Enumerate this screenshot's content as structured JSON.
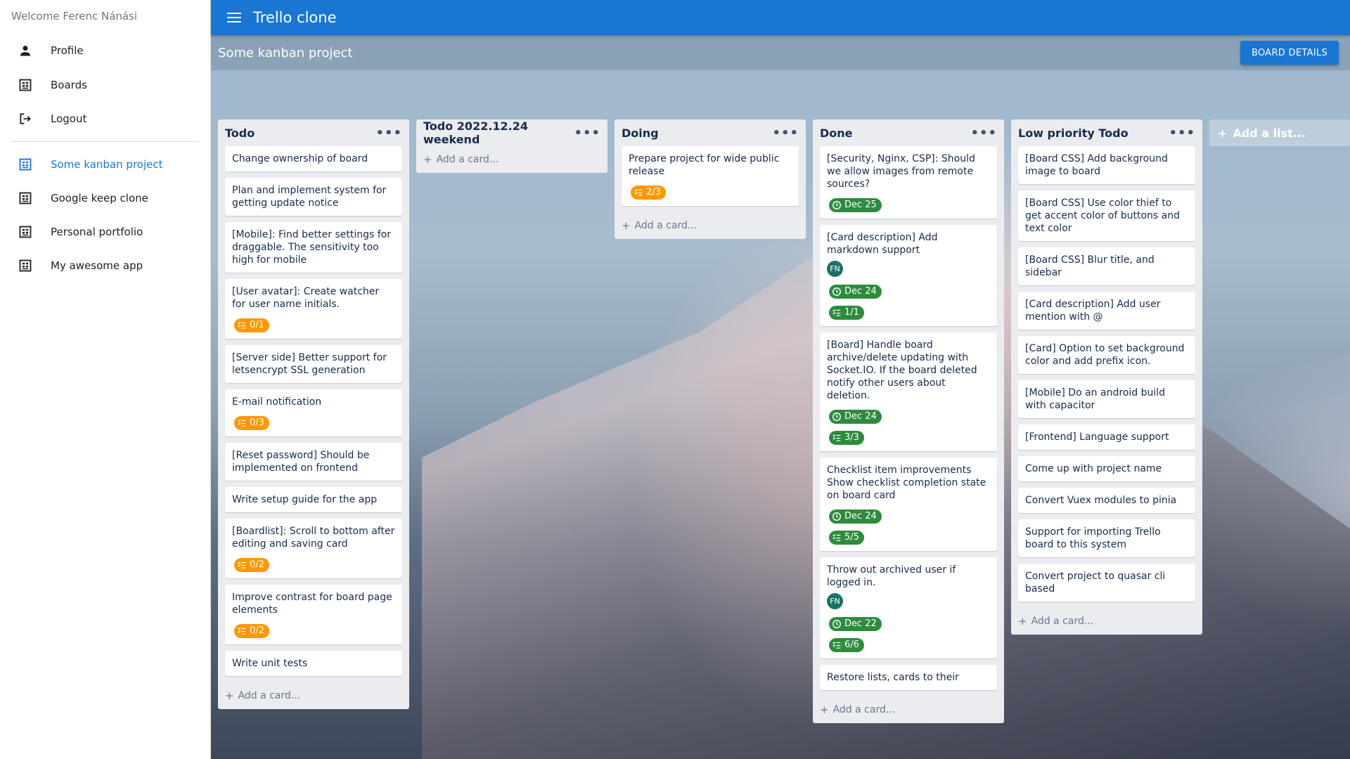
{
  "app": {
    "title": "Trello clone"
  },
  "sidebar": {
    "welcome": "Welcome Ferenc Nánási",
    "items": [
      {
        "label": "Profile",
        "icon": "person-icon"
      },
      {
        "label": "Boards",
        "icon": "board-icon"
      },
      {
        "label": "Logout",
        "icon": "logout-icon"
      }
    ],
    "boards": [
      {
        "label": "Some kanban project",
        "active": true
      },
      {
        "label": "Google keep clone"
      },
      {
        "label": "Personal portfolio"
      },
      {
        "label": "My awesome app"
      }
    ]
  },
  "board": {
    "name": "Some kanban project",
    "details_label": "BOARD DETAILS",
    "add_list_label": "Add a list...",
    "add_card_label": "Add a card..."
  },
  "colors": {
    "primary": "#1976d2",
    "checklist_badge": "#ff9800",
    "due_badge": "#2e8b3e",
    "avatar": "#1b7267"
  },
  "lists": [
    {
      "title": "Todo",
      "cards": [
        {
          "text": "Change ownership of board"
        },
        {
          "text": "Plan and implement system for getting update notice"
        },
        {
          "text": "[Mobile]: Find better settings for draggable. The sensitivity too high for mobile"
        },
        {
          "text": "[User avatar]: Create watcher for user name initials.",
          "checklist": "0/1"
        },
        {
          "text": "[Server side] Better support for letsencrypt SSL generation"
        },
        {
          "text": "E-mail notification",
          "checklist": "0/3"
        },
        {
          "text": "[Reset password] Should be implemented on frontend"
        },
        {
          "text": "Write setup guide for the app"
        },
        {
          "text": "[Boardlist]: Scroll to bottom after editing and saving card",
          "checklist": "0/2"
        },
        {
          "text": "Improve contrast for board page elements",
          "checklist": "0/2"
        },
        {
          "text": "Write unit tests"
        }
      ]
    },
    {
      "title": "Todo 2022.12.24 weekend",
      "cards": []
    },
    {
      "title": "Doing",
      "cards": [
        {
          "text": "Prepare project for wide public release",
          "checklist": "2/3"
        }
      ]
    },
    {
      "title": "Done",
      "cards": [
        {
          "text": "[Security, Nginx, CSP]: Should we allow images from remote sources?",
          "due": "Dec 25"
        },
        {
          "text": "[Card description] Add markdown support",
          "avatar": "FN",
          "due": "Dec 24",
          "checklist_done": "1/1"
        },
        {
          "text": "[Board] Handle board archive/delete updating with Socket.IO. If the board deleted notify other users about deletion.",
          "due": "Dec 24",
          "checklist_done": "3/3"
        },
        {
          "text": "Checklist item improvements Show checklist completion state on board card",
          "due": "Dec 24",
          "checklist_done": "5/5"
        },
        {
          "text": "Throw out archived user if logged in.",
          "avatar": "FN",
          "due": "Dec 22",
          "checklist_done": "6/6"
        },
        {
          "text": "Restore lists, cards to their"
        }
      ]
    },
    {
      "title": "Low priority Todo",
      "cards": [
        {
          "text": "[Board CSS] Add background image to board"
        },
        {
          "text": "[Board CSS] Use color thief to get accent color of buttons and text color"
        },
        {
          "text": "[Board CSS] Blur title, and sidebar"
        },
        {
          "text": "[Card description] Add user mention with @"
        },
        {
          "text": "[Card] Option to set background color and add prefix icon."
        },
        {
          "text": "[Mobile] Do an android build with capacitor"
        },
        {
          "text": "[Frontend] Language support"
        },
        {
          "text": "Come up with project name"
        },
        {
          "text": "Convert Vuex modules to pinia"
        },
        {
          "text": "Support for importing Trello board to this system"
        },
        {
          "text": "Convert project to quasar cli based"
        }
      ]
    }
  ]
}
